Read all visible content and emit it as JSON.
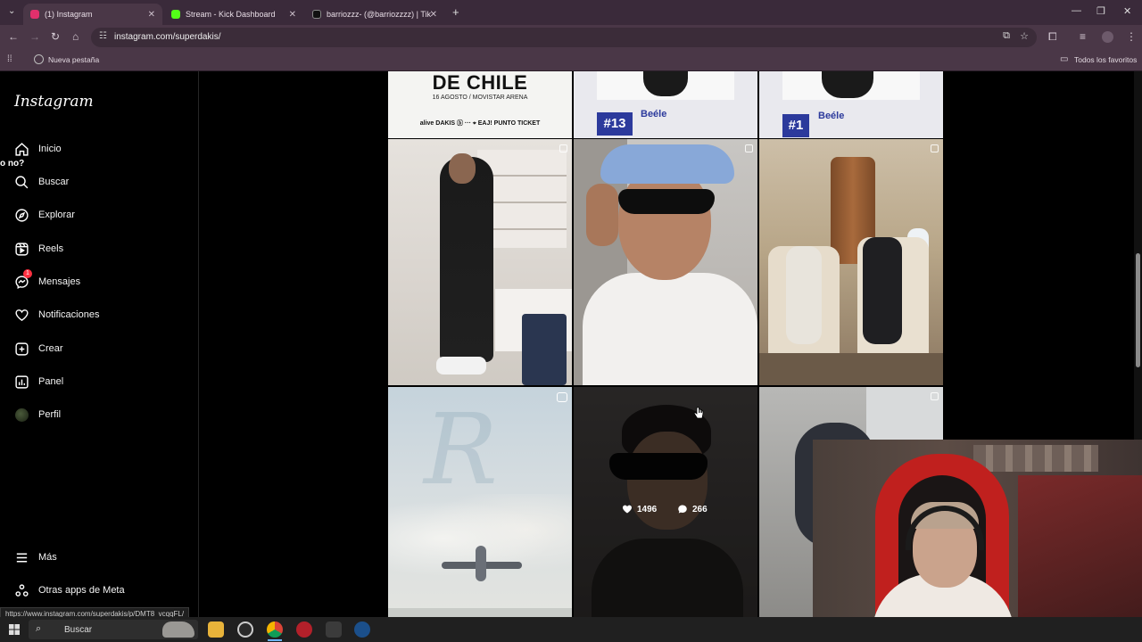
{
  "browser": {
    "tabs": [
      {
        "title": "(1) Instagram",
        "active": true,
        "color": "#e1306c"
      },
      {
        "title": "Stream - Kick Dashboard",
        "active": false,
        "color": "#53fc18"
      },
      {
        "title": "barriozzz- (@barriozzzz) | TikT",
        "active": false,
        "color": "#111111"
      }
    ],
    "url": "instagram.com/superdakis/",
    "bookmark": "Nueva pestaña",
    "all_bookmarks": "Todos los favoritos"
  },
  "sidebar": {
    "logo": "Instagram",
    "stray_text": "o no?",
    "items": [
      {
        "label": "Inicio",
        "icon": "home-icon"
      },
      {
        "label": "Buscar",
        "icon": "search-icon"
      },
      {
        "label": "Explorar",
        "icon": "compass-icon"
      },
      {
        "label": "Reels",
        "icon": "reels-icon"
      },
      {
        "label": "Mensajes",
        "icon": "messenger-icon",
        "badge": "1"
      },
      {
        "label": "Notificaciones",
        "icon": "heart-icon"
      },
      {
        "label": "Crear",
        "icon": "plus-square-icon"
      },
      {
        "label": "Panel",
        "icon": "chart-icon"
      },
      {
        "label": "Perfil",
        "icon": "avatar-icon"
      }
    ],
    "more": "Más",
    "meta_apps": "Otras apps de Meta"
  },
  "grid": {
    "poster": {
      "title": "DE CHILE",
      "subtitle": "16 AGOSTO / MOVISTAR ARENA",
      "sponsors": "alive DAKIS ⓑ ··· ⌖ EAJ! PUNTO TICKET"
    },
    "rank_cards": [
      {
        "rank": "#13",
        "artist": "Beéle"
      },
      {
        "rank": "#1",
        "artist": "Beéle"
      }
    ],
    "hover": {
      "likes": "1496",
      "comments": "266"
    }
  },
  "status_url": "https://www.instagram.com/superdakis/p/DMT8_vcqqFL/",
  "taskbar": {
    "search": "Buscar"
  }
}
